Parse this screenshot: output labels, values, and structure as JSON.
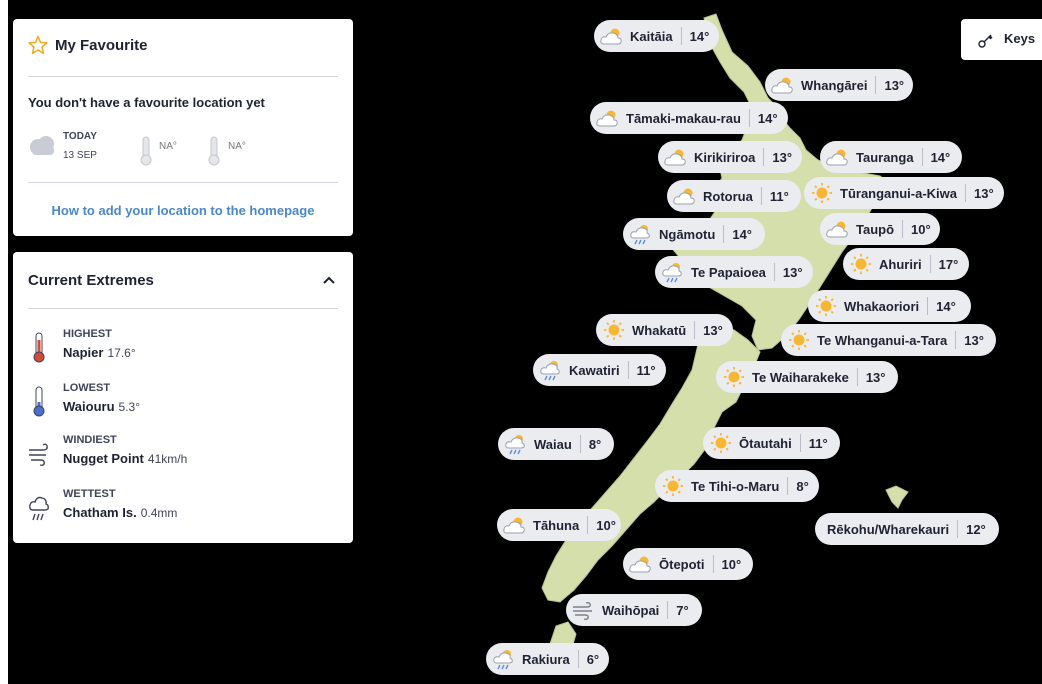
{
  "favourite": {
    "title": "My Favourite",
    "message": "You don't have a favourite location yet",
    "today_label": "TODAY",
    "today_date": "13 SEP",
    "max_temp": "NA°",
    "min_temp": "NA°",
    "howto_link": "How to add your location to the homepage",
    "icons": {
      "title": "star-outline-icon",
      "weather": "cloudy-icon",
      "thermo": "thermometer-icon"
    }
  },
  "extremes": {
    "title": "Current Extremes",
    "items": [
      {
        "label": "HIGHEST",
        "place": "Napier",
        "value": "17.6°",
        "icon": "thermometer-hot-icon"
      },
      {
        "label": "LOWEST",
        "place": "Waiouru",
        "value": "5.3°",
        "icon": "thermometer-cold-icon"
      },
      {
        "label": "WINDIEST",
        "place": "Nugget Point",
        "value": "41km/h",
        "icon": "wind-icon"
      },
      {
        "label": "WETTEST",
        "place": "Chatham Is.",
        "value": "0.4mm",
        "icon": "rain-cloud-icon"
      }
    ]
  },
  "keys": {
    "label": "Keys",
    "icon": "key-icon"
  },
  "colors": {
    "land": "#d4dfab",
    "sun": "#f7b733",
    "pill": "#ebecef",
    "link": "#4a87c9",
    "hot": "#d44a3a",
    "cold": "#4a6fd0"
  },
  "locations": [
    {
      "name": "Kaitāia",
      "temp": "14°",
      "icon": "partly-cloudy"
    },
    {
      "name": "Whangārei",
      "temp": "13°",
      "icon": "partly-cloudy"
    },
    {
      "name": "Tāmaki-makau-rau",
      "temp": "14°",
      "icon": "partly-cloudy"
    },
    {
      "name": "Kirikiriroa",
      "temp": "13°",
      "icon": "partly-cloudy"
    },
    {
      "name": "Tauranga",
      "temp": "14°",
      "icon": "partly-cloudy"
    },
    {
      "name": "Rotorua",
      "temp": "11°",
      "icon": "partly-cloudy"
    },
    {
      "name": "Tūranganui-a-Kiwa",
      "temp": "13°",
      "icon": "sunny"
    },
    {
      "name": "Taupō",
      "temp": "10°",
      "icon": "partly-cloudy"
    },
    {
      "name": "Ngāmotu",
      "temp": "14°",
      "icon": "showers"
    },
    {
      "name": "Ahuriri",
      "temp": "17°",
      "icon": "sunny"
    },
    {
      "name": "Te Papaioea",
      "temp": "13°",
      "icon": "showers"
    },
    {
      "name": "Whakaoriori",
      "temp": "14°",
      "icon": "sunny"
    },
    {
      "name": "Whakatū",
      "temp": "13°",
      "icon": "sunny"
    },
    {
      "name": "Te Whanganui-a-Tara",
      "temp": "13°",
      "icon": "sunny"
    },
    {
      "name": "Kawatiri",
      "temp": "11°",
      "icon": "showers"
    },
    {
      "name": "Te Waiharakeke",
      "temp": "13°",
      "icon": "sunny"
    },
    {
      "name": "Waiau",
      "temp": "8°",
      "icon": "showers"
    },
    {
      "name": "Ōtautahi",
      "temp": "11°",
      "icon": "sunny"
    },
    {
      "name": "Te Tihi-o-Maru",
      "temp": "8°",
      "icon": "sunny"
    },
    {
      "name": "Tāhuna",
      "temp": "10°",
      "icon": "partly-cloudy"
    },
    {
      "name": "Rēkohu/Wharekauri",
      "temp": "12°",
      "icon": "none"
    },
    {
      "name": "Ōtepoti",
      "temp": "10°",
      "icon": "partly-cloudy"
    },
    {
      "name": "Waihōpai",
      "temp": "7°",
      "icon": "windy"
    },
    {
      "name": "Rakiura",
      "temp": "6°",
      "icon": "showers"
    }
  ]
}
